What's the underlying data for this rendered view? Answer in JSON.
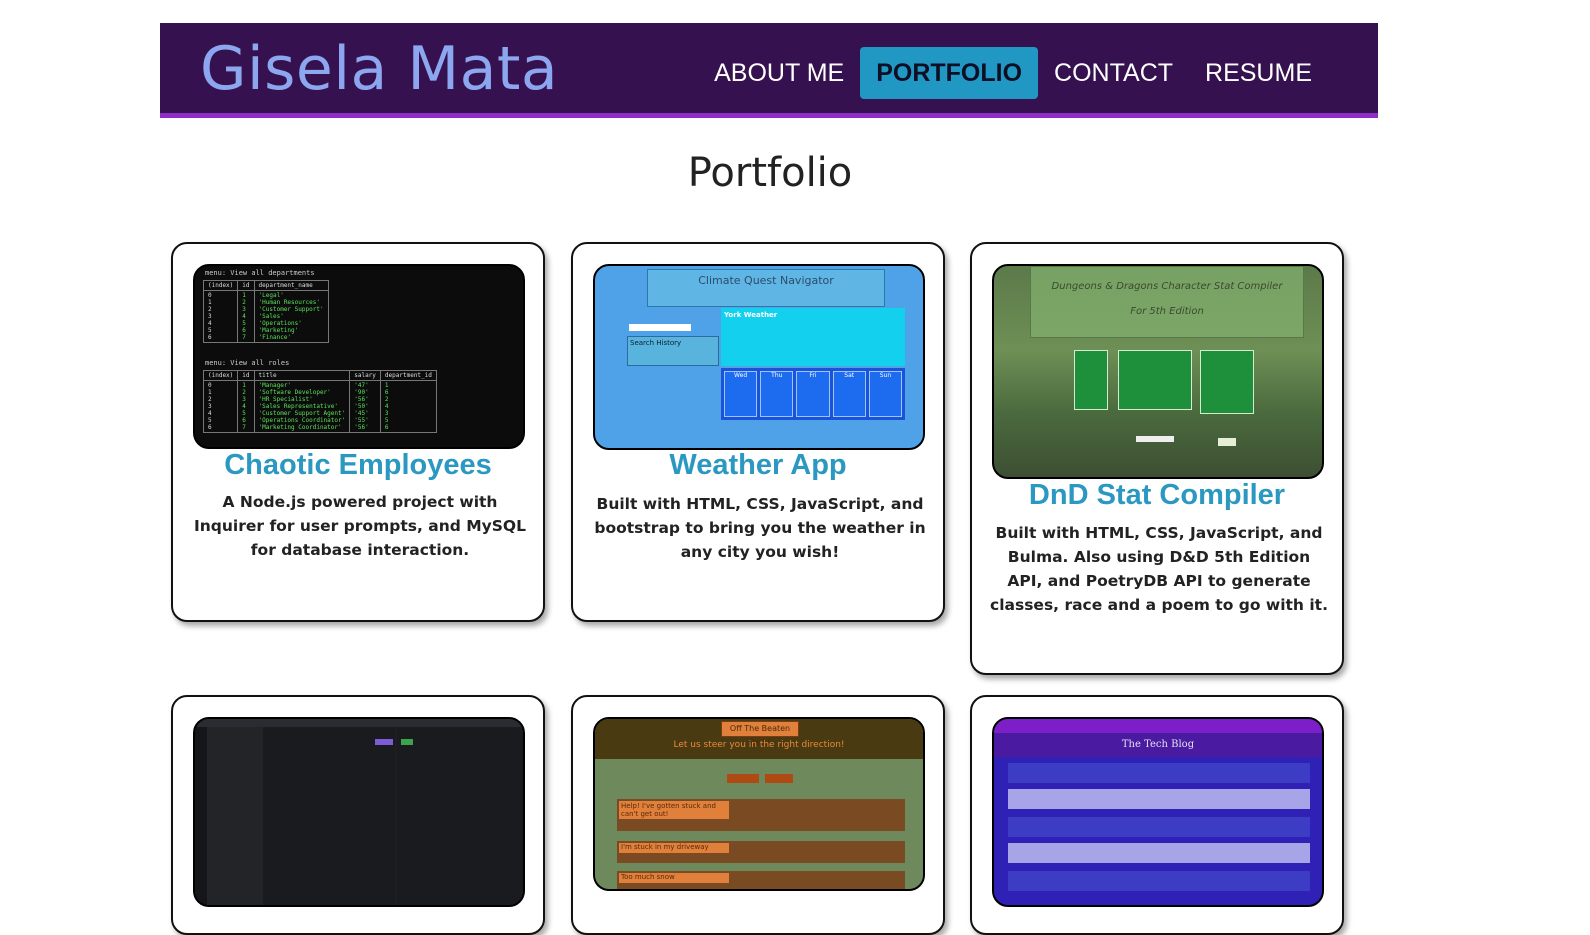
{
  "header": {
    "brand": "Gisela Mata",
    "nav": [
      "ABOUT ME",
      "PORTFOLIO",
      "CONTACT",
      "RESUME"
    ],
    "active_nav": "PORTFOLIO"
  },
  "page_title": "Portfolio",
  "projects": [
    {
      "title": "Chaotic Employees",
      "description": "A Node.js powered project with Inquirer for user prompts, and MySQL for database interaction.",
      "screenshot": {
        "menu1": "menu: View all departments",
        "menu2": "menu: View all roles"
      }
    },
    {
      "title": "Weather App",
      "description": "Built with HTML, CSS, JavaScript, and bootstrap to bring you the weather in any city you wish!",
      "screenshot": {
        "app_title": "Climate Quest Navigator",
        "city_heading": "York Weather",
        "history_label": "Search History",
        "days": [
          "Wed",
          "Thu",
          "Fri",
          "Sat",
          "Sun"
        ]
      }
    },
    {
      "title": "DnD Stat Compiler",
      "description": "Built with HTML, CSS, JavaScript, and Bulma. Also using D&D 5th Edition API, and PoetryDB API to generate classes, race and a poem to go with it.",
      "screenshot": {
        "app_title": "Dungeons & Dragons Character Stat Compiler",
        "subtitle": "For 5th Edition"
      }
    },
    {
      "title": "",
      "description": "",
      "screenshot": {}
    },
    {
      "title": "",
      "description": "",
      "screenshot": {
        "app_title": "Off The Beaten Path!",
        "tagline": "Let us steer you in the right direction!",
        "post1": "Help! I've gotten stuck and can't get out!",
        "post2": "I'm stuck in my driveway",
        "post3": "Too much snow"
      }
    },
    {
      "title": "",
      "description": "",
      "screenshot": {
        "app_title": "The Tech Blog"
      }
    }
  ],
  "colors": {
    "header_bg": "#35124f",
    "header_border": "#8d2fc6",
    "brand": "#8ca6ef",
    "accent": "#2198c4",
    "card_title": "#2a98c0"
  }
}
